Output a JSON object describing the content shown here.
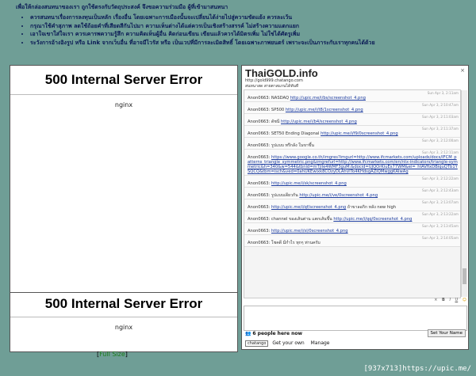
{
  "rules": {
    "heading": "เพื่อให้กล่องสนทนาของเรา ถูกใช้ตรงกับวัตถุประสงค์ จึงขอความร่วมมือ ผู้ที่เข้ามาสนทนา",
    "items": [
      "ควรสนทนาเรื่องการลงทุนเป็นหลัก เรื่องอื่น โดยเฉพาะการเมืองนั้นจะเปลี่ยนได้ง่ายไปสู่ความขัดแย้ง ควรละเว้น",
      "กรุณาใช้คำสุภาพ ลดใช้ถ้อยคำที่เสียดสีกันไปมา ความเห็นต่างได้แต่ควรเป็นเชิงสร้างสรรค์ ไม่สร้างความแตกแยก",
      "เอาใจเขาใส่ใจเรา ควรเคารพความรู้สึก ความคิดเห็นผู้อื่น คิดก่อนเขียน เขียนแล้วควรได้มิตรเพิ่ม ไม่ใช่ได้ศัตรูเพิ่ม",
      "ระวังการอ้างอิงรูป หรือ Link จากเว็บอื่น ที่อาจมีไวรัส หรือ เป็นเวปที่มีการละเมิดสิทธิ์ โดยเฉพาะภาพยนตร์ เพราะจะเป็นภาระกับเราทุกคนได้ด้วย"
    ]
  },
  "error_frames": [
    {
      "title": "500 Internal Server Error",
      "server": "nginx"
    },
    {
      "title": "500 Internal Server Error",
      "server": "nginx"
    }
  ],
  "full_size": {
    "open": "[",
    "link": "Full Size",
    "close": "]"
  },
  "chat": {
    "title": "ThaiGOLD.info",
    "url": "http://gold999.chatango.com",
    "description": "สนทนาสด สายตาสแกนได้ทันที",
    "close": "×",
    "messages": [
      {
        "user": "Anon0663:",
        "text": "NASDAQ",
        "link": "http://upic.me/i/bs/screenshot_4.png",
        "time": "Sun Apr 3, 2:11am"
      },
      {
        "user": "Anon0663:",
        "text": "SP500",
        "link": "http://upic.me/i/t8/1screenshot_4.png",
        "time": "Sun Apr 3, 2:10:47am"
      },
      {
        "user": "Anon0663:",
        "text": "ดัชนี",
        "link": "http://upic.me/i/b4/screenshot_4.png",
        "time": "Sun Apr 3, 2:11:03am"
      },
      {
        "user": "Anon0663:",
        "text": "SET50 Ending Diagonal",
        "link": "http://upic.me/i/f9/0screenshot_4.png",
        "time": "Sun Apr 3, 2:11:37am"
      },
      {
        "user": "Anon0663:",
        "text": "รูปแบบ ทรึกลัง ในขาขึ้น",
        "link": "",
        "time": "Sun Apr 3, 2:12:00am"
      },
      {
        "user": "Anon0663:",
        "text": "",
        "link": "https://www.google.co.th/imgres?imgurl=http://www.ifcmarkets.com/uploads/docs/IFCM_patterns_triangle_symmetric.png&imgrefurl=http://www.ifcmarkets.com/en/ntx-indicators/triangle-symmetric&h=340&w=544&tbnid=mTjlle4WMF3guM:&docid=UJQOrKiuEs77WM&ei=_hIAVfixDBiquQTb1YSQCQ&tbm=isch&ved=0ahUKEwixk8COzyDLAhVITo4KHdsgAZIQMwggKAIwAg",
        "time": "Sun Apr 3, 2:12:11am"
      },
      {
        "user": "Anon0663:",
        "text": "",
        "link": "http://upic.me/i/sk/screenshot_4.png",
        "time": "Sun Apr 3, 2:12:22am"
      },
      {
        "user": "Anon0663:",
        "text": "รูปแบบเดียวกัน",
        "link": "http://upic.me/i/ve/0screenshot_4.png",
        "time": "Sun Apr 3, 2:12:43am"
      },
      {
        "user": "Anon0663:",
        "text": "",
        "link": "http://upic.me/i/qf/screenshot_4.png",
        "time": "Sun Apr 3, 2:13:07am",
        "suffix": "ถ้าขาลอกิก หลัง new high"
      },
      {
        "user": "Anon0663:",
        "text": "channel ของเส้นต่าน แตกเส้นขึ้น",
        "link": "http://upic.me/i/qq/0screenshot_4.png",
        "time": "Sun Apr 3, 2:13:22am"
      },
      {
        "user": "Anon0663:",
        "text": "",
        "link": "http://upic.me/i/sl/0screenshot_4.png",
        "time": "Sun Apr 3, 2:13:45am"
      },
      {
        "user": "Anon0663:",
        "text": "โชคดี มีกำไร ทุกๆ ท่านครับ",
        "link": "",
        "time": "Sun Apr 3, 2:14:05am"
      }
    ],
    "toolbar": {
      "close": "×",
      "bold": "B",
      "italic": "I",
      "underline": "U"
    },
    "people_count": "6 people here now",
    "set_name": "Set Your Name",
    "chatango_logo": "chatango",
    "get_your_own": "Get your own",
    "manage": "Manage"
  },
  "status": {
    "dims": "[937x713]",
    "url": "https://upic.me/"
  }
}
